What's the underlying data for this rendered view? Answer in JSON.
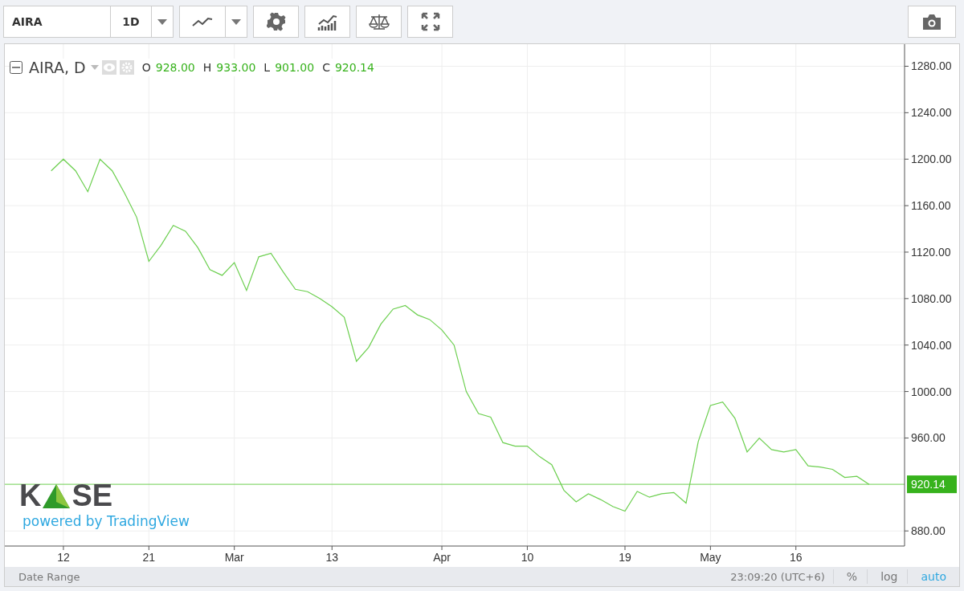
{
  "toolbar": {
    "symbol": "AIRA",
    "interval": "1D"
  },
  "legend": {
    "title": "AIRA, D",
    "ohlc": [
      {
        "key": "O",
        "value": "928.00"
      },
      {
        "key": "H",
        "value": "933.00"
      },
      {
        "key": "L",
        "value": "901.00"
      },
      {
        "key": "C",
        "value": "920.14"
      }
    ]
  },
  "chart_data": {
    "type": "line",
    "grid": true,
    "ylim": [
      867,
      1299
    ],
    "categories": [
      null,
      "12",
      null,
      null,
      null,
      null,
      null,
      null,
      "21",
      null,
      null,
      null,
      null,
      null,
      null,
      "Mar",
      null,
      null,
      null,
      null,
      null,
      null,
      null,
      "13",
      null,
      null,
      null,
      null,
      null,
      null,
      null,
      null,
      "Apr",
      null,
      null,
      null,
      null,
      null,
      null,
      "10",
      null,
      null,
      null,
      null,
      null,
      null,
      null,
      "19",
      null,
      null,
      null,
      null,
      null,
      null,
      "May",
      null,
      null,
      null,
      null,
      null,
      null,
      "16",
      null,
      null,
      null,
      null,
      null,
      null
    ],
    "series": [
      {
        "color": "#6ccf4f",
        "values": [
          1190,
          1200,
          1190,
          1172,
          1200,
          1190,
          1171,
          1150,
          1112,
          1126,
          1143,
          1138,
          1124,
          1105,
          1100,
          1111,
          1087,
          1116,
          1119,
          1103,
          1088,
          1086,
          1080,
          1073,
          1064,
          1026,
          1038,
          1058,
          1071,
          1074,
          1066,
          1062,
          1053,
          1040,
          1000,
          981,
          978,
          956,
          953,
          953,
          944,
          937,
          915,
          905,
          912,
          907,
          901,
          897,
          914,
          909,
          912,
          913,
          904,
          957,
          988,
          991,
          977,
          948,
          960,
          950,
          948,
          950,
          936,
          935,
          933,
          926,
          927,
          920
        ]
      }
    ],
    "yticks": [
      {
        "value": 880,
        "label": "880.00"
      },
      {
        "value": 960,
        "label": "960.00"
      },
      {
        "value": 1000,
        "label": "1000.00"
      },
      {
        "value": 1040,
        "label": "1040.00"
      },
      {
        "value": 1080,
        "label": "1080.00"
      },
      {
        "value": 1120,
        "label": "1120.00"
      },
      {
        "value": 1160,
        "label": "1160.00"
      },
      {
        "value": 1200,
        "label": "1200.00"
      },
      {
        "value": 1240,
        "label": "1240.00"
      },
      {
        "value": 1280,
        "label": "1280.00"
      }
    ],
    "ref_lines": [
      {
        "axis": "y",
        "value": 920.14,
        "label": "920.14"
      }
    ]
  },
  "logo": {
    "left": "K",
    "right": "SE",
    "tagline": "powered by TradingView"
  },
  "status_bar": {
    "date_range": "Date Range",
    "time": "23:09:20 (UTC+6)",
    "scales": [
      {
        "label": "%",
        "selected": false
      },
      {
        "label": "log",
        "selected": false
      },
      {
        "label": "auto",
        "selected": true
      }
    ]
  }
}
